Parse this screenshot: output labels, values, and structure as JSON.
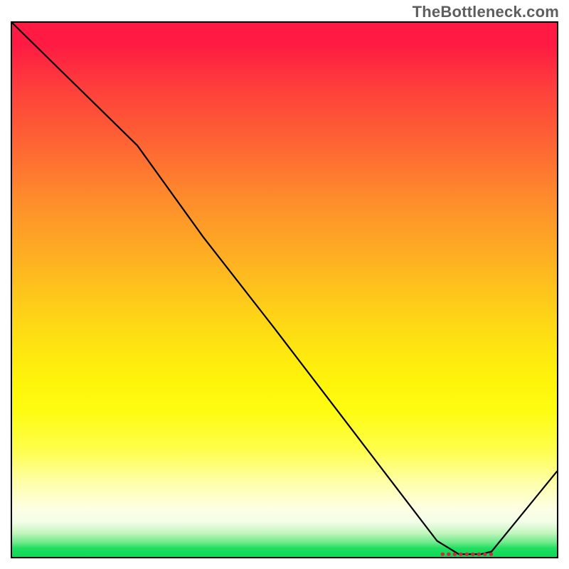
{
  "watermark": "TheBottleneck.com",
  "chart_data": {
    "type": "line",
    "title": "",
    "xlabel": "",
    "ylabel": "",
    "xlim": [
      0,
      100
    ],
    "ylim": [
      0,
      100
    ],
    "series": [
      {
        "name": "bottleneck-curve",
        "x": [
          0,
          10,
          23,
          35,
          48,
          60,
          72,
          78,
          82,
          86,
          88,
          92,
          100
        ],
        "values": [
          100,
          90,
          77,
          60,
          43,
          27,
          11,
          3,
          0.5,
          0.5,
          1,
          6,
          16
        ]
      }
    ],
    "marker": {
      "name": "optimal-range",
      "x_start": 79,
      "x_end": 88,
      "y": 0.5
    },
    "background_gradient": {
      "stops": [
        {
          "pct": 0,
          "color": "#fe1a42"
        },
        {
          "pct": 50,
          "color": "#fec51c"
        },
        {
          "pct": 80,
          "color": "#fefe4c"
        },
        {
          "pct": 100,
          "color": "#0cda55"
        }
      ]
    }
  }
}
